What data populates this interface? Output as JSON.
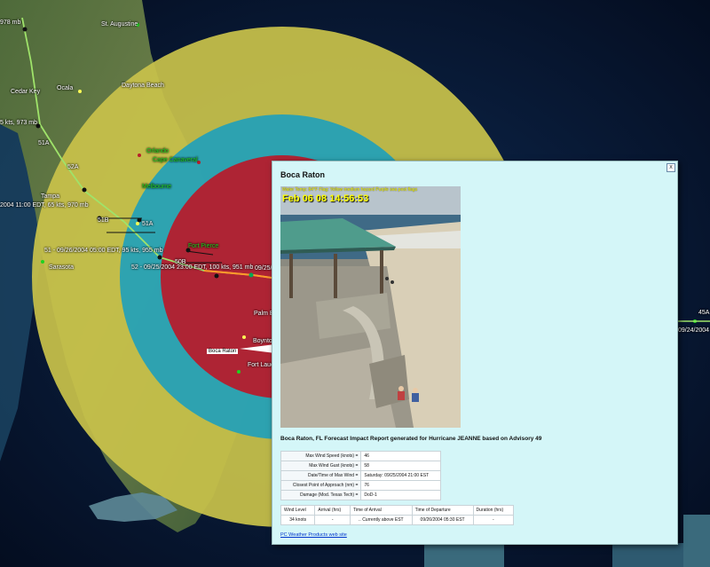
{
  "popup": {
    "title": "Boca Raton",
    "close_label": "x",
    "webcam": {
      "caption": "Water Temp: 84°F   Flag: Yellow medium hazard   Purple sea pest flags",
      "timestamp": "Feb 06 08 14:56:53"
    },
    "report_heading": "Boca Raton, FL Forecast Impact Report generated for Hurricane JEANNE based on Advisory 49",
    "stats": [
      {
        "label": "Max Wind Speed (knots) =",
        "value": "46"
      },
      {
        "label": "Max Wind Gust (knots) =",
        "value": "58"
      },
      {
        "label": "Date/Time of Max Wind =",
        "value": "Saturday: 09/25/2004 21:00 EST"
      },
      {
        "label": "Closest Point of Approach (nm) =",
        "value": "76"
      },
      {
        "label": "Damage (Mod. Texas Tech) =",
        "value": "DoD-1"
      }
    ],
    "timing_headers": [
      "Wind Level",
      "Arrival (hrs)",
      "Time of Arrival",
      "Time of Departure",
      "Duration (hrs)"
    ],
    "timing_rows": [
      [
        "34 knots",
        "-",
        ".. Currently above EST",
        "09/26/2004 05:30 EST",
        "-"
      ]
    ],
    "link_text": "PC Weather Products web site"
  },
  "map": {
    "labels": {
      "mb978": "978 mb",
      "st_augustine": "St. Augustine",
      "cedar_key": "Cedar Key",
      "ocala": "Ocala",
      "daytona": "Daytona Beach",
      "kts973": "5 kts, 973 mb",
      "p51a": "51A",
      "p52a": "52A",
      "orlando": "Orlando",
      "cape_canaveral": "Cape Canaveral",
      "melbourne": "Melbourne",
      "tampa": "Tampa",
      "adv_tampa": "2004 11:00 EDT, 65 kts, 970 mb",
      "p51b": "51B",
      "p51a2": "51A",
      "fort_pierce": "Fort Pierce",
      "adv51": "51 - 09/26/2004 05:00 EDT, 95 kts, 955 mb",
      "sarasota": "Sarasota",
      "p50b": "50B",
      "adv52": "52 - 09/25/2004 23:00 EDT, 100 kts, 951 mb",
      "d0925": "09/25/",
      "palm_beach": "Palm B",
      "boynton": "Boynton",
      "boca_raton": "Boca Raton",
      "fort_lauderdale": "Fort Laude",
      "p45a": "45A",
      "d0924": "09/24/2004"
    }
  },
  "colors": {
    "wind34": "#c8c24a",
    "wind50": "#22a0b8",
    "wind64": "#b81a2a",
    "track": "#9fe36a",
    "popup_bg": "#d4f6f8"
  }
}
